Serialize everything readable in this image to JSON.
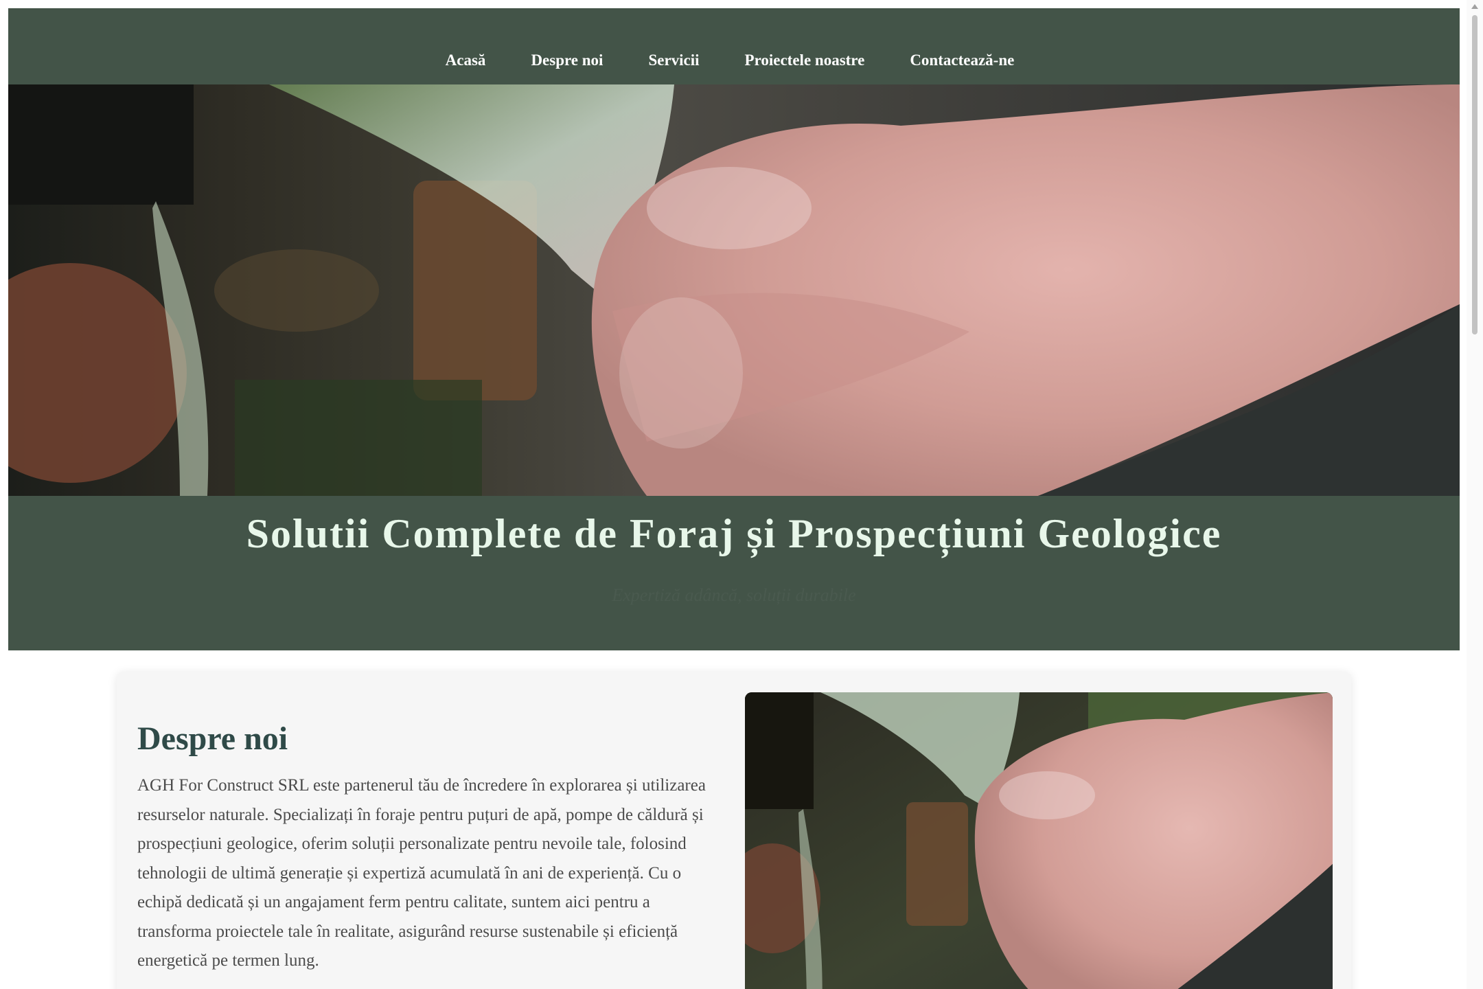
{
  "nav": {
    "items": [
      {
        "label": "Acasă"
      },
      {
        "label": "Despre noi"
      },
      {
        "label": "Servicii"
      },
      {
        "label": "Proiectele noastre"
      },
      {
        "label": "Contactează-ne"
      }
    ]
  },
  "hero": {
    "title": "Solutii Complete de Foraj și Prospecțiuni Geologice",
    "subtitle": "Expertiză adâncă, soluții durabile"
  },
  "about": {
    "title": "Despre noi",
    "body": "AGH For Construct SRL este partenerul tău de încredere în explorarea și utilizarea resurselor naturale. Specializați în foraje pentru puțuri de apă, pompe de căldură și prospecțiuni geologice, oferim soluții personalizate pentru nevoile tale, folosind tehnologii de ultimă generație și expertiză acumulată în ani de experiență. Cu o echipă dedicată și un angajament ferm pentru calitate, suntem aici pentru a transforma proiectele tale în realitate, asigurând resurse sustenabile și eficiență energetică pe termen lung."
  },
  "colors": {
    "nav_bg": "#435448",
    "hero_title": "#e8f7ea",
    "about_title": "#2f4a48"
  }
}
